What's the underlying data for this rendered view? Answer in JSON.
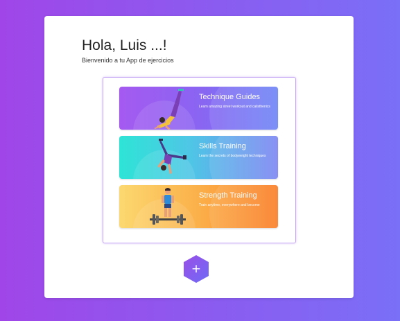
{
  "header": {
    "greeting": "Hola, Luis ...!",
    "subtitle": "Bienvenido a tu App de ejercicios"
  },
  "guides": [
    {
      "title": "Technique Guides",
      "description": "Learn amazing street workout and calisthenics",
      "illustration": "handstand-figure-icon"
    },
    {
      "title": "Skills Training",
      "description": "Learn the secrets of bodyweight techniques",
      "illustration": "cartwheel-figure-icon"
    },
    {
      "title": "Strength Training",
      "description": "Train anytime, everywhere and become",
      "illustration": "weightlifter-figure-icon"
    }
  ],
  "fab": {
    "label": "+",
    "icon": "plus-icon",
    "color": "#7a5cf2"
  },
  "colors": {
    "background_start": "#a046e8",
    "background_end": "#7a6ff7",
    "panel_border": "#c4a6f4"
  }
}
